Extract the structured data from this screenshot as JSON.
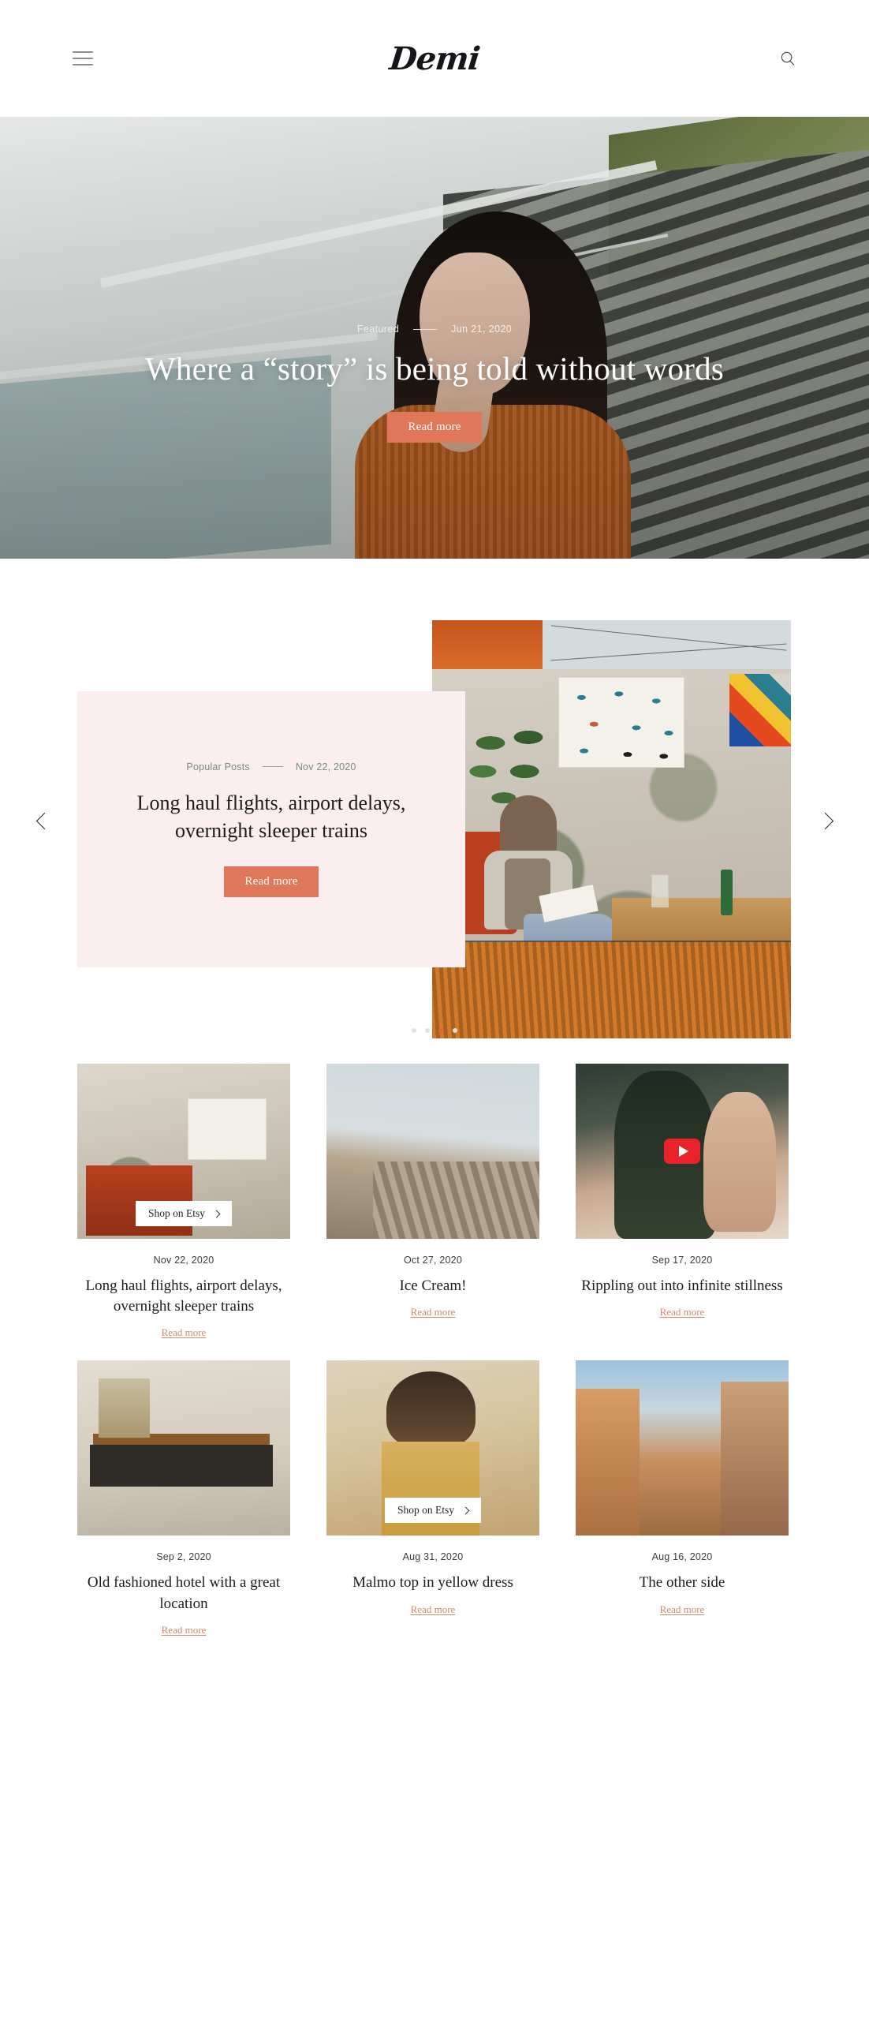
{
  "header": {
    "menu_label": "menu-toggle",
    "brand": "Demi",
    "search_label": "Search"
  },
  "hero": {
    "category": "Featured",
    "date": "Jun 21, 2020",
    "title": "Where a “story” is being told without words",
    "cta": "Read more"
  },
  "carousel": {
    "category": "Popular Posts",
    "date": "Nov 22, 2020",
    "title": "Long haul flights, airport delays, overnight sleeper trains",
    "cta": "Read more",
    "prev_label": "Previous slide",
    "next_label": "Next slide",
    "dots": [
      {
        "active": false
      },
      {
        "active": false
      },
      {
        "active": true
      },
      {
        "active": false
      }
    ]
  },
  "posts": [
    {
      "date": "Nov 22, 2020",
      "title": "Long haul flights, airport delays, overnight sleeper trains",
      "link": "Read more",
      "badge": "Shop on Etsy",
      "has_badge": true,
      "has_video": false
    },
    {
      "date": "Oct 27, 2020",
      "title": "Ice Cream!",
      "link": "Read more",
      "badge": "",
      "has_badge": false,
      "has_video": false
    },
    {
      "date": "Sep 17, 2020",
      "title": "Rippling out into infinite stillness",
      "link": "Read more",
      "badge": "",
      "has_badge": false,
      "has_video": true
    },
    {
      "date": "Sep 2, 2020",
      "title": "Old fashioned hotel with a great location",
      "link": "Read more",
      "badge": "",
      "has_badge": false,
      "has_video": false
    },
    {
      "date": "Aug 31, 2020",
      "title": "Malmo top in yellow dress",
      "link": "Read more",
      "badge": "Shop on Etsy",
      "has_badge": true,
      "has_video": false
    },
    {
      "date": "Aug 16, 2020",
      "title": "The other side",
      "link": "Read more",
      "badge": "",
      "has_badge": false,
      "has_video": false
    }
  ],
  "colors": {
    "accent": "#e0765a",
    "link": "#cf8a6f",
    "card_bg": "#fbeeee",
    "meta_green": "#7b8a7b",
    "youtube_red": "#e8242a"
  }
}
